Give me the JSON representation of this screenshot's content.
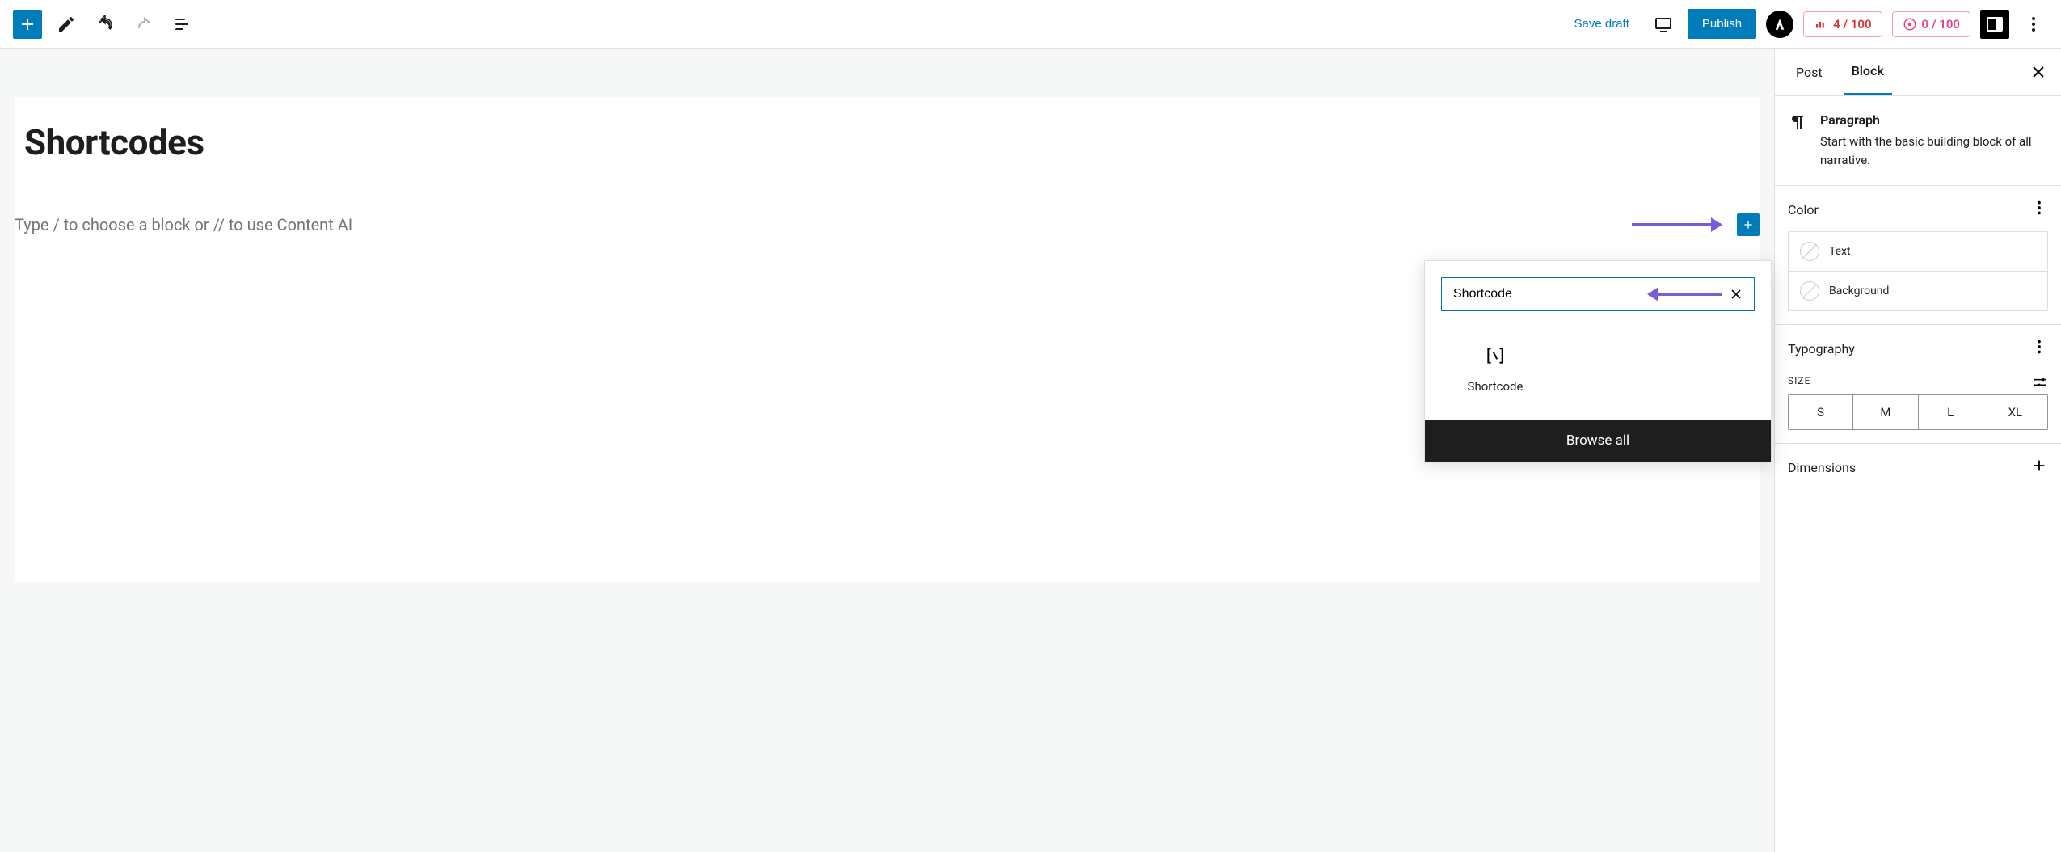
{
  "toolbar": {
    "save_draft": "Save draft",
    "publish": "Publish",
    "scores": [
      {
        "value": "4 / 100",
        "kind": "seo"
      },
      {
        "value": "0 / 100",
        "kind": "ai"
      }
    ]
  },
  "post": {
    "title": "Shortcodes",
    "placeholder": "Type / to choose a block or // to use Content AI"
  },
  "inserter": {
    "search_value": "Shortcode",
    "results": [
      {
        "label": "Shortcode"
      }
    ],
    "browse_all": "Browse all"
  },
  "sidebar": {
    "tabs": {
      "post": "Post",
      "block": "Block"
    },
    "block": {
      "name": "Paragraph",
      "description": "Start with the basic building block of all narrative."
    },
    "panels": {
      "color": {
        "title": "Color",
        "items": {
          "text": "Text",
          "background": "Background"
        }
      },
      "typography": {
        "title": "Typography",
        "size_label": "SIZE",
        "sizes": [
          "S",
          "M",
          "L",
          "XL"
        ]
      },
      "dimensions": {
        "title": "Dimensions"
      }
    }
  }
}
